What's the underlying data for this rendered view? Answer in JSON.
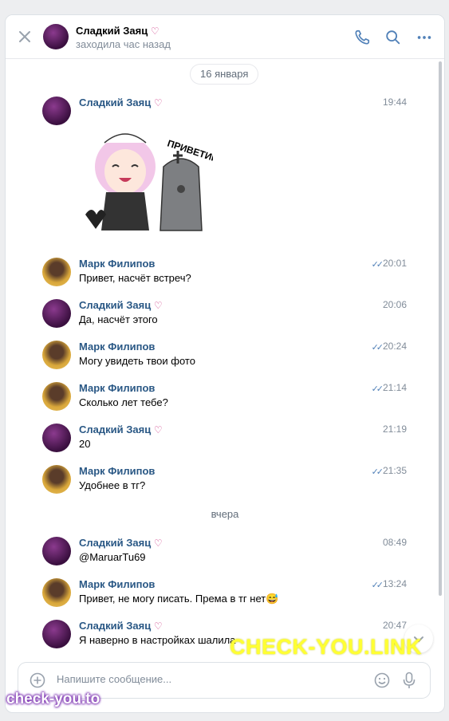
{
  "header": {
    "contact_name": "Сладкий Заяц",
    "contact_status": "заходила час назад"
  },
  "date_dividers": [
    "16 января",
    "вчера"
  ],
  "messages": [
    {
      "author": "Сладкий Заяц",
      "text": "",
      "time": "19:44",
      "read_check": false,
      "avatar": "zayac",
      "sticker_text": "ПРИВЕТИК!"
    },
    {
      "author": "Марк Филипов",
      "text": "Привет, насчёт встреч?",
      "time": "20:01",
      "read_check": true,
      "avatar": "mark"
    },
    {
      "author": "Сладкий Заяц",
      "text": "Да, насчёт этого",
      "time": "20:06",
      "read_check": false,
      "avatar": "zayac"
    },
    {
      "author": "Марк Филипов",
      "text": "Могу увидеть твои фото",
      "time": "20:24",
      "read_check": true,
      "avatar": "mark"
    },
    {
      "author": "Марк Филипов",
      "text": "Сколько лет тебе?",
      "time": "21:14",
      "read_check": true,
      "avatar": "mark"
    },
    {
      "author": "Сладкий Заяц",
      "text": "20",
      "time": "21:19",
      "read_check": false,
      "avatar": "zayac"
    },
    {
      "author": "Марк Филипов",
      "text": "Удобнее в тг?",
      "time": "21:35",
      "read_check": true,
      "avatar": "mark"
    },
    {
      "author": "Сладкий Заяц",
      "text": "@MaruarTu69",
      "time": "08:49",
      "read_check": false,
      "avatar": "zayac"
    },
    {
      "author": "Марк Филипов",
      "text": "Привет, не могу писать. Према в тг нет😅",
      "time": "13:24",
      "read_check": true,
      "avatar": "mark"
    },
    {
      "author": "Сладкий Заяц",
      "text": "Я наверно в настройках шалила",
      "time": "20:47",
      "read_check": false,
      "avatar": "zayac"
    }
  ],
  "composer": {
    "placeholder": "Напишите сообщение..."
  },
  "watermarks": {
    "big": "CHECK-YOU.LINK",
    "small": "check-you.to"
  },
  "colors": {
    "accent": "#2a5885",
    "check": "#5181b8",
    "heart": "#d24a8f",
    "watermark_yellow": "#ffff33"
  },
  "icons": [
    "close-icon",
    "phone-icon",
    "search-icon",
    "more-icon",
    "heart-icon",
    "double-check-icon",
    "plus-icon",
    "smile-icon",
    "mic-icon",
    "chevron-down-icon"
  ]
}
